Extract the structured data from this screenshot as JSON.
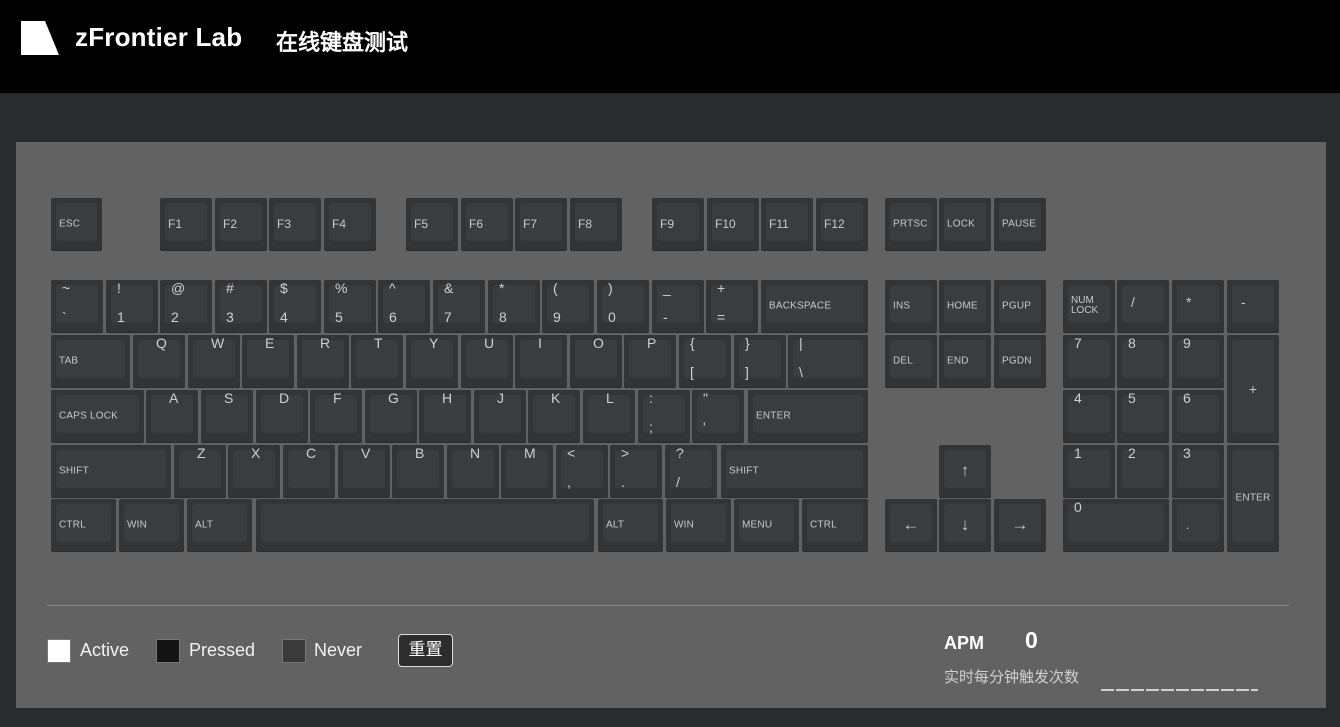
{
  "header": {
    "logo_icon": "zfrontier-logo-icon",
    "brand": "zFrontier Lab",
    "subtitle": "在线键盘测试"
  },
  "keyboard": {
    "function_row": {
      "esc": "ESC",
      "f_keys": [
        "F1",
        "F2",
        "F3",
        "F4",
        "F5",
        "F6",
        "F7",
        "F8",
        "F9",
        "F10",
        "F11",
        "F12"
      ],
      "system": [
        "PRTSC",
        "LOCK",
        "PAUSE"
      ]
    },
    "number_row": [
      {
        "top": "~",
        "bottom": "`"
      },
      {
        "top": "!",
        "bottom": "1"
      },
      {
        "top": "@",
        "bottom": "2"
      },
      {
        "top": "#",
        "bottom": "3"
      },
      {
        "top": "$",
        "bottom": "4"
      },
      {
        "top": "%",
        "bottom": "5"
      },
      {
        "top": "^",
        "bottom": "6"
      },
      {
        "top": "&",
        "bottom": "7"
      },
      {
        "top": "*",
        "bottom": "8"
      },
      {
        "top": "(",
        "bottom": "9"
      },
      {
        "top": ")",
        "bottom": "0"
      },
      {
        "top": "_",
        "bottom": "-"
      },
      {
        "top": "+",
        "bottom": "="
      }
    ],
    "backspace": "BACKSPACE",
    "tab": "TAB",
    "qwerty": [
      "Q",
      "W",
      "E",
      "R",
      "T",
      "Y",
      "U",
      "I",
      "O",
      "P"
    ],
    "brackets": [
      {
        "top": "{",
        "bottom": "["
      },
      {
        "top": "}",
        "bottom": "]"
      },
      {
        "top": "|",
        "bottom": "\\"
      }
    ],
    "caps_lock": "CAPS LOCK",
    "home_row": [
      "A",
      "S",
      "D",
      "F",
      "G",
      "H",
      "J",
      "K",
      "L"
    ],
    "home_punct": [
      {
        "top": ":",
        "bottom": ";"
      },
      {
        "top": "\"",
        "bottom": "'"
      }
    ],
    "enter": "ENTER",
    "shift_left": "SHIFT",
    "bottom_letters": [
      "Z",
      "X",
      "C",
      "V",
      "B",
      "N",
      "M"
    ],
    "bottom_punct": [
      {
        "top": "<",
        "bottom": ","
      },
      {
        "top": ">",
        "bottom": "."
      },
      {
        "top": "?",
        "bottom": "/"
      }
    ],
    "shift_right": "SHIFT",
    "space_row": {
      "ctrl_l": "CTRL",
      "win_l": "WIN",
      "alt_l": "ALT",
      "space": "",
      "alt_r": "ALT",
      "win_r": "WIN",
      "menu": "MENU",
      "ctrl_r": "CTRL"
    },
    "nav": {
      "ins": "INS",
      "home": "HOME",
      "pgup": "PGUP",
      "del": "DEL",
      "end": "END",
      "pgdn": "PGDN"
    },
    "arrows": {
      "up": "↑",
      "left": "←",
      "down": "↓",
      "right": "→"
    },
    "numpad": {
      "numlock": "NUM LOCK",
      "slash": "/",
      "star": "*",
      "minus": "-",
      "plus": "+",
      "n7": "7",
      "n8": "8",
      "n9": "9",
      "n4": "4",
      "n5": "5",
      "n6": "6",
      "n1": "1",
      "n2": "2",
      "n3": "3",
      "n0": "0",
      "dot": ".",
      "enter": "ENTER"
    }
  },
  "legend": {
    "active": "Active",
    "pressed": "Pressed",
    "never": "Never",
    "reset": "重置",
    "colors": {
      "active": "#ffffff",
      "pressed": "#141414",
      "never": "#3a3a3a"
    }
  },
  "apm": {
    "label": "APM",
    "value": "0",
    "description": "实时每分钟触发次数"
  }
}
